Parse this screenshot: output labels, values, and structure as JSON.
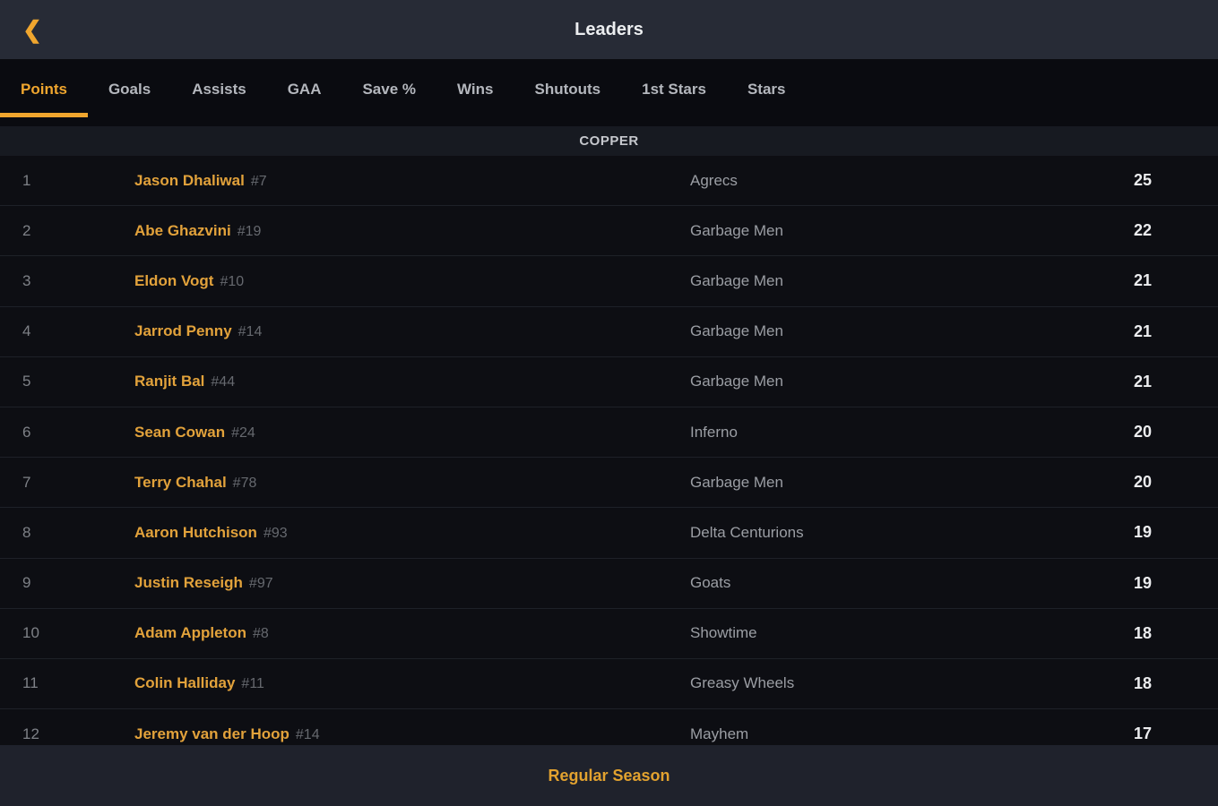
{
  "header": {
    "back_icon": "chevron-left",
    "back_glyph": "❮",
    "title": "Leaders"
  },
  "tabs": [
    {
      "label": "Points",
      "active": true
    },
    {
      "label": "Goals",
      "active": false
    },
    {
      "label": "Assists",
      "active": false
    },
    {
      "label": "GAA",
      "active": false
    },
    {
      "label": "Save %",
      "active": false
    },
    {
      "label": "Wins",
      "active": false
    },
    {
      "label": "Shutouts",
      "active": false
    },
    {
      "label": "1st Stars",
      "active": false
    },
    {
      "label": "Stars",
      "active": false
    }
  ],
  "division": "COPPER",
  "table": {
    "rows": [
      {
        "rank": "1",
        "name": "Jason Dhaliwal",
        "jersey": "#7",
        "team": "Agrecs",
        "value": "25"
      },
      {
        "rank": "2",
        "name": "Abe Ghazvini",
        "jersey": "#19",
        "team": "Garbage Men",
        "value": "22"
      },
      {
        "rank": "3",
        "name": "Eldon Vogt",
        "jersey": "#10",
        "team": "Garbage Men",
        "value": "21"
      },
      {
        "rank": "4",
        "name": "Jarrod Penny",
        "jersey": "#14",
        "team": "Garbage Men",
        "value": "21"
      },
      {
        "rank": "5",
        "name": "Ranjit Bal",
        "jersey": "#44",
        "team": "Garbage Men",
        "value": "21"
      },
      {
        "rank": "6",
        "name": "Sean Cowan",
        "jersey": "#24",
        "team": "Inferno",
        "value": "20"
      },
      {
        "rank": "7",
        "name": "Terry Chahal",
        "jersey": "#78",
        "team": "Garbage Men",
        "value": "20"
      },
      {
        "rank": "8",
        "name": "Aaron Hutchison",
        "jersey": "#93",
        "team": "Delta Centurions",
        "value": "19"
      },
      {
        "rank": "9",
        "name": "Justin Reseigh",
        "jersey": "#97",
        "team": "Goats",
        "value": "19"
      },
      {
        "rank": "10",
        "name": "Adam Appleton",
        "jersey": "#8",
        "team": "Showtime",
        "value": "18"
      },
      {
        "rank": "11",
        "name": "Colin Halliday",
        "jersey": "#11",
        "team": "Greasy Wheels",
        "value": "18"
      },
      {
        "rank": "12",
        "name": "Jeremy van der Hoop",
        "jersey": "#14",
        "team": "Mayhem",
        "value": "17"
      }
    ]
  },
  "footer": {
    "label": "Regular Season"
  },
  "colors": {
    "accent": "#F0A62E",
    "player_name": "#E2A23B",
    "top_bar_bg": "#272B36",
    "tab_bar_bg": "#0A0B10",
    "row_bg": "#0D0E13",
    "bottom_bar_bg": "#1F222C"
  }
}
